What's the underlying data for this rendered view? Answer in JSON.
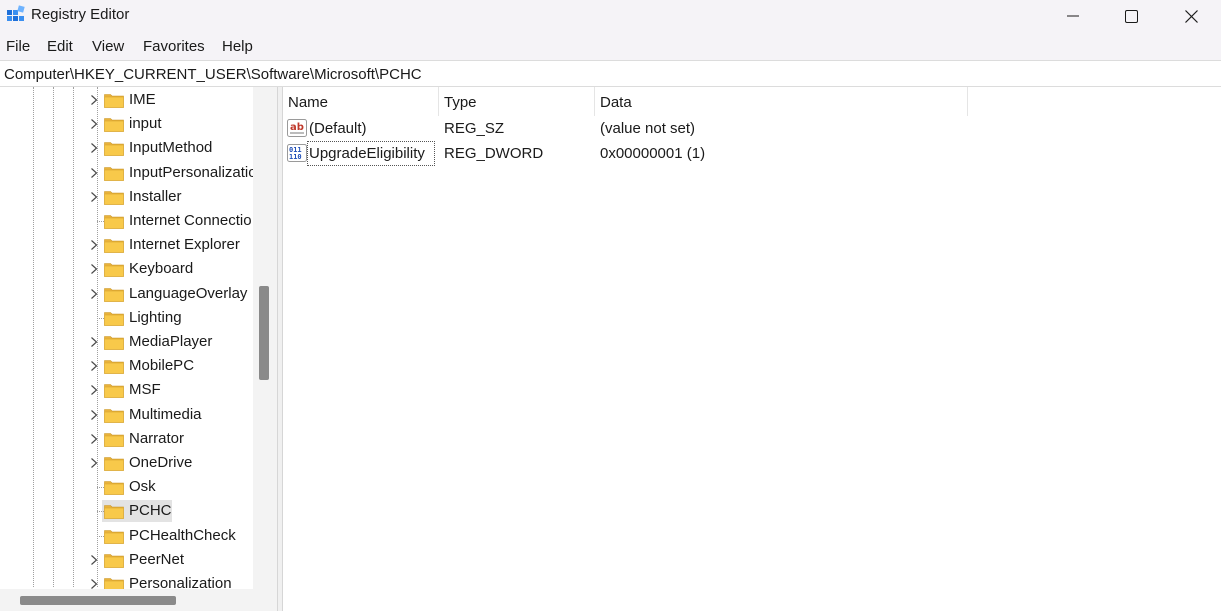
{
  "window": {
    "title": "Registry Editor",
    "icon": "regedit-icon",
    "controls": [
      "minimize-icon",
      "maximize-icon",
      "close-icon"
    ]
  },
  "menu": [
    "File",
    "Edit",
    "View",
    "Favorites",
    "Help"
  ],
  "address": "Computer\\HKEY_CURRENT_USER\\Software\\Microsoft\\PCHC",
  "tree": {
    "items": [
      {
        "label": "IME",
        "expandable": true
      },
      {
        "label": "input",
        "expandable": true
      },
      {
        "label": "InputMethod",
        "expandable": true
      },
      {
        "label": "InputPersonalizatio",
        "expandable": true
      },
      {
        "label": "Installer",
        "expandable": true
      },
      {
        "label": "Internet Connectio",
        "expandable": false
      },
      {
        "label": "Internet Explorer",
        "expandable": true
      },
      {
        "label": "Keyboard",
        "expandable": true
      },
      {
        "label": "LanguageOverlay",
        "expandable": true
      },
      {
        "label": "Lighting",
        "expandable": false
      },
      {
        "label": "MediaPlayer",
        "expandable": true
      },
      {
        "label": "MobilePC",
        "expandable": true
      },
      {
        "label": "MSF",
        "expandable": true
      },
      {
        "label": "Multimedia",
        "expandable": true
      },
      {
        "label": "Narrator",
        "expandable": true
      },
      {
        "label": "OneDrive",
        "expandable": true
      },
      {
        "label": "Osk",
        "expandable": false
      },
      {
        "label": "PCHC",
        "expandable": false,
        "selected": true
      },
      {
        "label": "PCHealthCheck",
        "expandable": false
      },
      {
        "label": "PeerNet",
        "expandable": true
      },
      {
        "label": "Personalization",
        "expandable": true
      }
    ]
  },
  "list": {
    "columns": [
      "Name",
      "Type",
      "Data"
    ],
    "rows": [
      {
        "icon": "string-value-icon",
        "name": "(Default)",
        "type": "REG_SZ",
        "data": "(value not set)"
      },
      {
        "icon": "binary-value-icon",
        "name": "UpgradeEligibility",
        "type": "REG_DWORD",
        "data": "0x00000001 (1)",
        "focused": true
      }
    ]
  },
  "colors": {
    "titlebar_bg": "#f5f3f7",
    "folder": "#f8c94a",
    "selection": "#e3e3e3"
  }
}
